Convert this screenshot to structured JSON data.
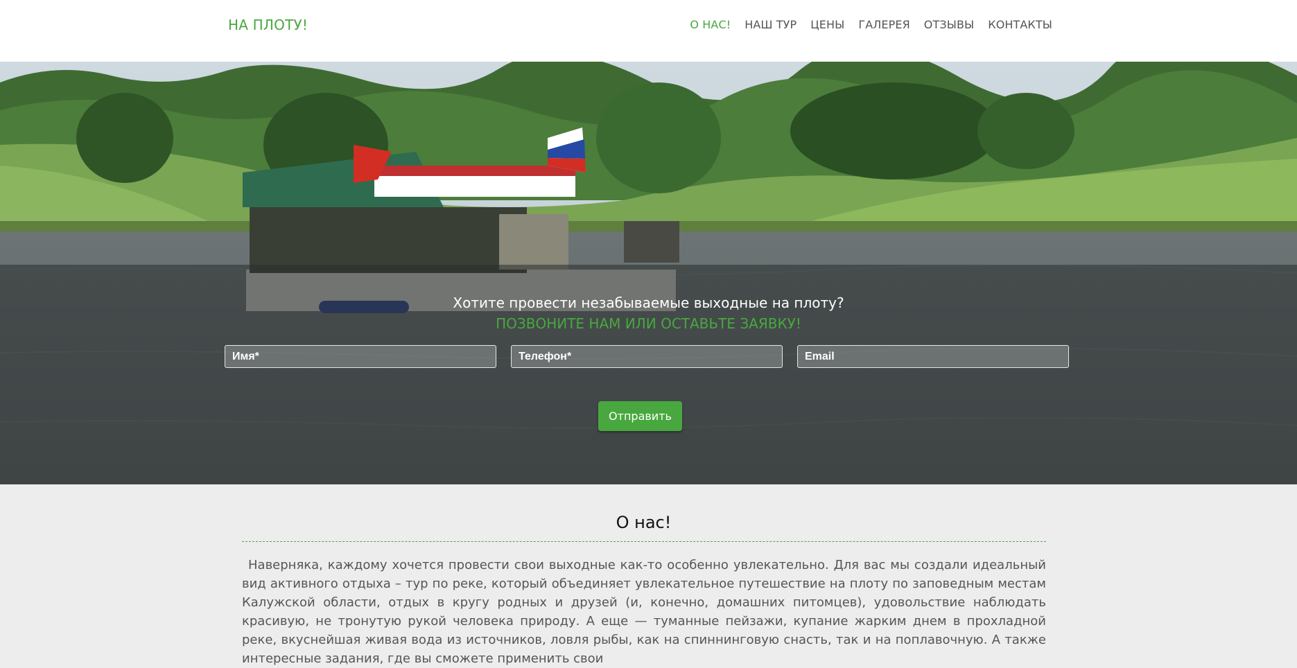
{
  "header": {
    "logo": "НА ПЛОТУ!",
    "nav": [
      {
        "label": "О НАС!",
        "active": true
      },
      {
        "label": "НАШ ТУР"
      },
      {
        "label": "ЦЕНЫ"
      },
      {
        "label": "ГАЛЕРЕЯ"
      },
      {
        "label": "ОТЗЫВЫ"
      },
      {
        "label": "КОНТАКТЫ"
      }
    ]
  },
  "hero": {
    "title": "Хотите провести незабываемые выходные на плоту?",
    "subtitle": "ПОЗВОНИТЕ НАМ ИЛИ ОСТАВЬТЕ ЗАЯВКУ!",
    "form": {
      "name_placeholder": "Имя*",
      "phone_placeholder": "Телефон*",
      "email_placeholder": "Email",
      "submit_label": "Отправить"
    }
  },
  "about": {
    "title": "О нас!",
    "text": "Наверняка, каждому хочется провести свои выходные как-то особенно увлекательно. Для вас мы создали идеальный вид активного отдыха – тур по реке, который объединяет увлекательное путешествие на плоту по заповедным местам Калужской области, отдых в кругу родных и друзей (и, конечно, домашних питомцев), удовольствие наблюдать красивую, не тронутую рукой человека природу. А еще — туманные пейзажи, купание жарким днем в прохладной реке, вкуснейшая живая вода из источников, ловля рыбы, как на спиннинговую снасть, так и на поплавочную. А также интересные задания, где вы сможете применить свои"
  },
  "colors": {
    "accent": "#48a83f",
    "header_bg": "#ffffff",
    "page_bg": "#ededed"
  }
}
